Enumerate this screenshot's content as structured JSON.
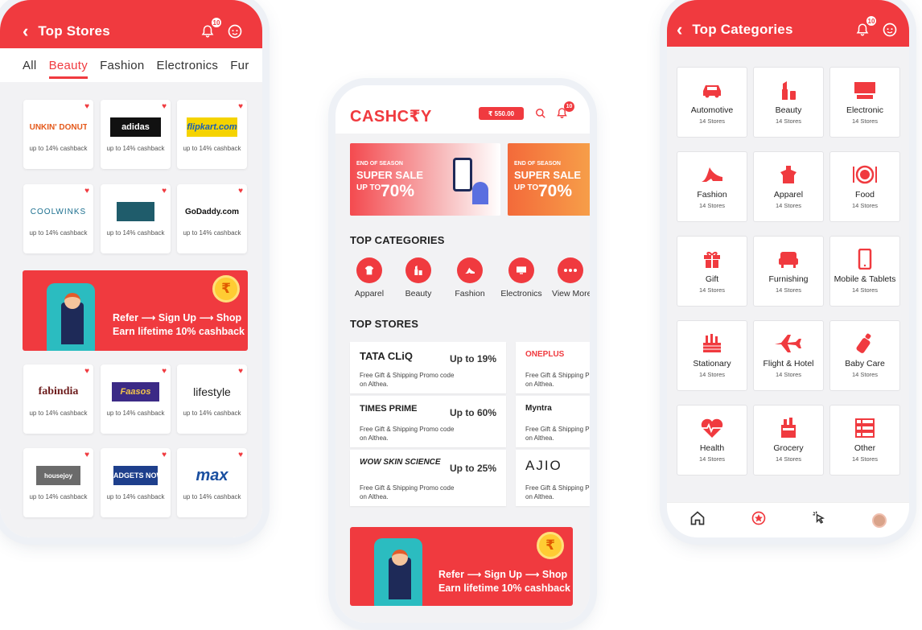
{
  "colors": {
    "accent": "#f03a3f",
    "background": "#f2f2f4",
    "coin": "#ffcc33"
  },
  "stores_screen": {
    "title": "Top Stores",
    "notification_count": "10",
    "tabs": [
      "All",
      "Beauty",
      "Fashion",
      "Electronics",
      "Fur"
    ],
    "active_tab": "Beauty",
    "cashback_text": "up to 14% cashback",
    "stores_top": [
      {
        "name": "DUNKIN' DONUTS",
        "color": "#e4591b"
      },
      {
        "name": "adidas",
        "color": "#ffffff"
      },
      {
        "name": "flipkart.com",
        "color": "#1a5fb4"
      },
      {
        "name": "COOLWINKS",
        "color": "#1b6f8f"
      },
      {
        "name": "",
        "color": "#1f5c6b"
      },
      {
        "name": "GoDaddy.com",
        "color": "#111111"
      }
    ],
    "stores_bottom": [
      {
        "name": "fabindia",
        "color": "#6e1e1e"
      },
      {
        "name": "Faasos",
        "color": "#f3c64a"
      },
      {
        "name": "lifestyle",
        "color": "#222222"
      },
      {
        "name": "housejoy",
        "color": "#ffffff"
      },
      {
        "name": "GADGETS NOW",
        "color": "#ffffff"
      },
      {
        "name": "max",
        "color": "#1a4fa0"
      }
    ],
    "refer_line1": "Refer ⟶ Sign Up ⟶ Shop",
    "refer_line2": "Earn lifetime 10% cashback",
    "coin_symbol": "₹"
  },
  "home_screen": {
    "brand": "CASHC₹Y",
    "wallet": "₹ 550.00",
    "notification_count": "10",
    "banners": [
      {
        "eyebrow": "END OF SEASON",
        "title": "SUPER SALE",
        "prefix": "UP TO",
        "value": "70%"
      },
      {
        "eyebrow": "END OF SEASON",
        "title": "SUPER SALE",
        "prefix": "UP TO",
        "value": "70%"
      }
    ],
    "categories_heading": "TOP CATEGORIES",
    "categories": [
      "Apparel",
      "Beauty",
      "Fashion",
      "Electronics",
      "View More"
    ],
    "stores_heading": "TOP STORES",
    "top_stores": [
      {
        "name": "TATA CLiQ",
        "cashback": "Up to 19%",
        "promo": "Free Gift & Shipping Promo code on Althea."
      },
      {
        "name": "TIMES PRIME",
        "cashback": "Up to 60%",
        "promo": "Free Gift & Shipping Promo code on Althea."
      },
      {
        "name": "WOW SKIN SCIENCE",
        "cashback": "Up to 25%",
        "promo": "Free Gift & Shipping Promo code on Althea."
      },
      {
        "name": "ONEPLUS",
        "cashback": "",
        "promo": "Free Gift & Shipping Promo code on Althea."
      },
      {
        "name": "Myntra",
        "cashback": "",
        "promo": "Free Gift & Shipping Promo code on Althea."
      },
      {
        "name": "AJIO",
        "cashback": "",
        "promo": "Free Gift & Shipping Promo code on Althea."
      }
    ],
    "refer_line1": "Refer ⟶ Sign Up ⟶ Shop",
    "refer_line2": "Earn lifetime 10% cashback",
    "coin_symbol": "₹"
  },
  "categories_screen": {
    "title": "Top Categories",
    "notification_count": "10",
    "categories": [
      {
        "name": "Automotive",
        "count": "14 Stores",
        "icon": "car-icon"
      },
      {
        "name": "Beauty",
        "count": "14 Stores",
        "icon": "lipstick-icon"
      },
      {
        "name": "Electronic",
        "count": "14 Stores",
        "icon": "tv-icon"
      },
      {
        "name": "Fashion",
        "count": "14 Stores",
        "icon": "heel-icon"
      },
      {
        "name": "Apparel",
        "count": "14 Stores",
        "icon": "shirt-icon"
      },
      {
        "name": "Food",
        "count": "14 Stores",
        "icon": "plate-icon"
      },
      {
        "name": "Gift",
        "count": "14 Stores",
        "icon": "gift-icon"
      },
      {
        "name": "Furnishing",
        "count": "14 Stores",
        "icon": "armchair-icon"
      },
      {
        "name": "Mobile & Tablets",
        "count": "14 Stores",
        "icon": "phone-icon"
      },
      {
        "name": "Stationary",
        "count": "14 Stores",
        "icon": "pencil-icon"
      },
      {
        "name": "Flight & Hotel",
        "count": "14 Stores",
        "icon": "plane-icon"
      },
      {
        "name": "Baby Care",
        "count": "14 Stores",
        "icon": "bottle-icon"
      },
      {
        "name": "Health",
        "count": "14 Stores",
        "icon": "heartbeat-icon"
      },
      {
        "name": "Grocery",
        "count": "14 Stores",
        "icon": "basket-icon"
      },
      {
        "name": "Other",
        "count": "14 Stores",
        "icon": "grid-icon"
      }
    ]
  }
}
